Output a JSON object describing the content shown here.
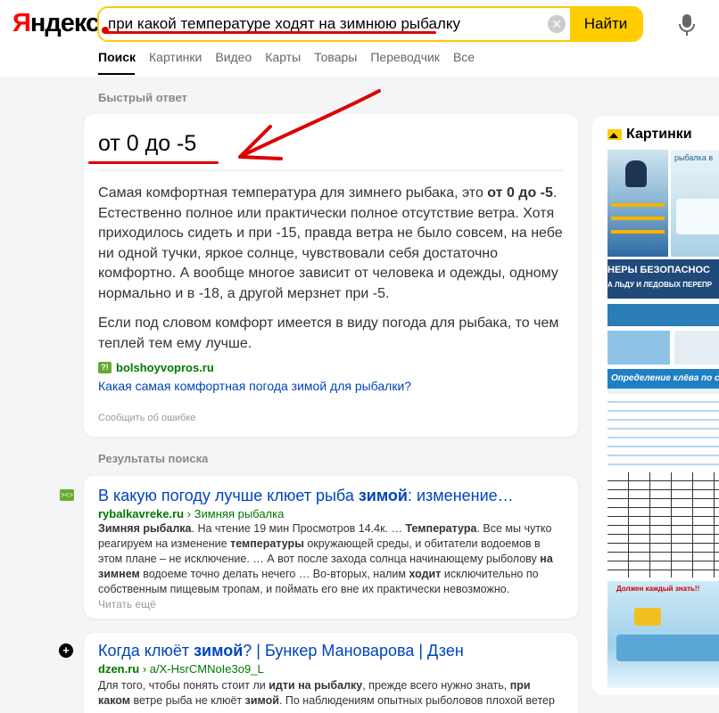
{
  "header": {
    "logo": "Яндекс",
    "search_query": "при какой температуре ходят на зимнюю рыбалку",
    "search_button": "Найти"
  },
  "tabs": [
    "Поиск",
    "Картинки",
    "Видео",
    "Карты",
    "Товары",
    "Переводчик",
    "Все"
  ],
  "quick_answer": {
    "section_label": "Быстрый ответ",
    "answer": "от 0 до -5",
    "paragraph1_before": "Самая комфортная температура для зимнего рыбака, это ",
    "paragraph1_bold": "от 0 до -5",
    "paragraph1_after": ". Естественно полное или практически полное отсутствие ветра. Хотя приходилось сидеть и при -15, правда ветра не было совсем, на небе ни одной тучки, яркое солнце, чувствовали себя достаточно комфортно. А вообще многое зависит от человека и одежды, одному нормально и в -18, а другой мерзнет при -5.",
    "paragraph2": "Если под словом комфорт имеется в виду погода для рыбака, то чем теплей тем ему лучше.",
    "source_icon": "?!",
    "source_domain": "bolshoyvopros.ru",
    "source_link": "Какая самая комфортная погода зимой для рыбалки?",
    "report": "Сообщить об ошибке"
  },
  "results_label": "Результаты поиска",
  "results": [
    {
      "title_before": "В какую погоду лучше клюет рыба ",
      "title_bold": "зимой",
      "title_after": ": изменение…",
      "domain": "rybalkavreke.ru",
      "breadcrumb": " › Зимняя рыбалка",
      "snippet": [
        {
          "t": "Зимняя рыбалка",
          "b": true
        },
        {
          "t": ". На чтение 19 мин Просмотров 14.4к. … ",
          "b": false
        },
        {
          "t": "Температура",
          "b": true
        },
        {
          "t": ". Все мы чутко реагируем на изменение ",
          "b": false
        },
        {
          "t": "температуры",
          "b": true
        },
        {
          "t": " окружающей среды, и обитатели водоемов в этом плане – не исключение. … А вот после захода солнца начинающему рыболову ",
          "b": false
        },
        {
          "t": "на зимнем",
          "b": true
        },
        {
          "t": " водоеме точно делать нечего … Во-вторых, налим ",
          "b": false
        },
        {
          "t": "ходит",
          "b": true
        },
        {
          "t": " исключительно по собственным пищевым тропам, и поймать его вне их практически невозможно.",
          "b": false
        }
      ],
      "read_more": "Читать ещё"
    },
    {
      "title_before": "Когда клюёт ",
      "title_bold": "зимой",
      "title_after": "? | Бункер Мановарова | Дзен",
      "domain": "dzen.ru",
      "breadcrumb": " › a/X-HsrCMNoIe3o9_L",
      "snippet": [
        {
          "t": "Для того, чтобы понять стоит ли ",
          "b": false
        },
        {
          "t": "идти на рыбалку",
          "b": true
        },
        {
          "t": ", прежде всего нужно знать, ",
          "b": false
        },
        {
          "t": "при каком",
          "b": true
        },
        {
          "t": " ветре рыба не клюёт ",
          "b": false
        },
        {
          "t": "зимой",
          "b": true
        },
        {
          "t": ". По наблюдениям опытных рыболовов плохой ветер",
          "b": false
        }
      ]
    }
  ],
  "images_panel": {
    "title": "Картинки",
    "pic1_text": "рыбалка в",
    "pic2_text": "НЕРЫ БЕЗОПАСНОС",
    "pic2_sub": "А ЛЬДУ И ЛЕДОВЫХ ПЕРЕПР",
    "pic3_text": "Определение клёва по с",
    "pic5_text": "Должен каждый знать!!"
  }
}
